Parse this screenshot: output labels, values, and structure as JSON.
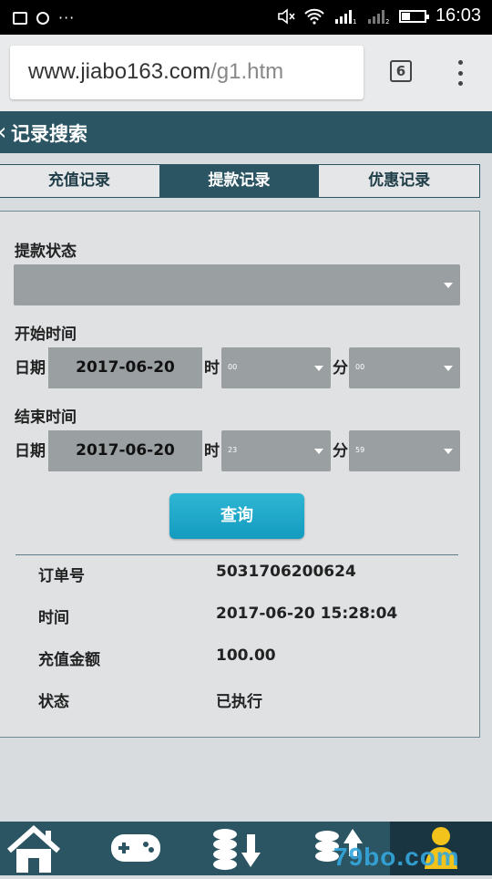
{
  "status_bar": {
    "time": "16:03",
    "dots": "···"
  },
  "browser": {
    "url_host": "www.jiabo163.com",
    "url_path": "/g1.htm",
    "tab_count": "6"
  },
  "header": {
    "back": "‹",
    "title": "记录搜索"
  },
  "tabs": [
    {
      "label": "充值记录",
      "active": false
    },
    {
      "label": "提款记录",
      "active": true
    },
    {
      "label": "优惠记录",
      "active": false
    }
  ],
  "form": {
    "status_label": "提款状态",
    "status_value": "",
    "start_label": "开始时间",
    "end_label": "结束时间",
    "date_label": "日期",
    "hour_label": "时",
    "minute_label": "分",
    "start": {
      "date": "2017-06-20",
      "hour": "00",
      "minute": "00"
    },
    "end": {
      "date": "2017-06-20",
      "hour": "23",
      "minute": "59"
    },
    "query_button": "查询"
  },
  "result": [
    {
      "label": "订单号",
      "value": "5031706200624"
    },
    {
      "label": "时间",
      "value": "2017-06-20 15:28:04"
    },
    {
      "label": "充值金额",
      "value": "100.00"
    },
    {
      "label": "状态",
      "value": "已执行"
    }
  ],
  "bottom_nav": [
    {
      "icon": "home-icon"
    },
    {
      "icon": "gamepad-icon"
    },
    {
      "icon": "coins-withdraw-icon"
    },
    {
      "icon": "coins-deposit-icon"
    },
    {
      "icon": "user-icon",
      "active": true
    }
  ],
  "watermark": "79bo.com",
  "colors": {
    "primary": "#2b5563",
    "accent": "#1ba6c9",
    "panel": "#dfe1e3",
    "field": "#9a9fa2"
  }
}
